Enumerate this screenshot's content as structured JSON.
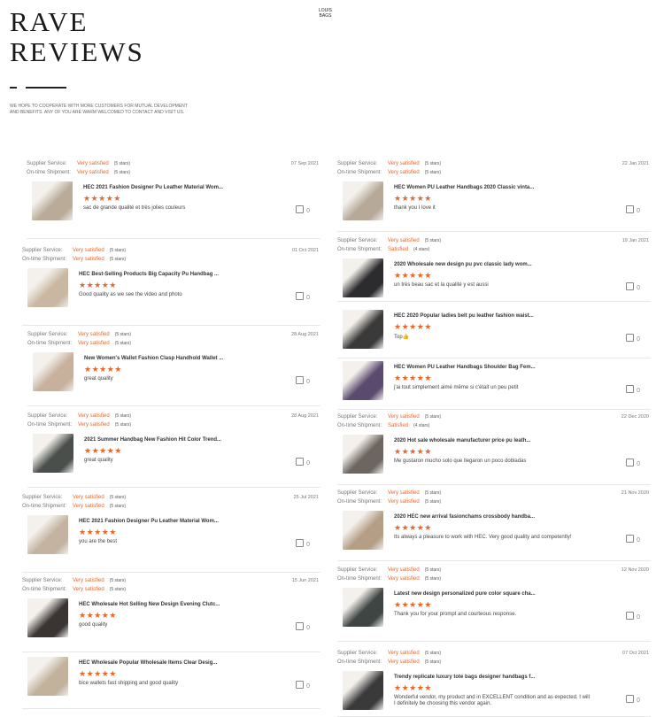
{
  "header": {
    "title_line1": "RAVE",
    "title_line2": "REVIEWS",
    "brand_line1": "LOUIS",
    "brand_line2": "BAGS",
    "intro_line1": "WE HOPE TO COOPERATE WITH MORE CUSTOMERS FOR MUTUAL DEVELOPMENT",
    "intro_line2": "AND BENEFITS. ANY OF YOU ARE WARM WELCOMED TO CONTACT AND VISIT US."
  },
  "labels": {
    "supplier": "Supplier Service:",
    "shipment": "On-time Shipment:"
  },
  "colors": {
    "accent": "#e7672a"
  },
  "reviews_left": [
    {
      "date": "07 Sep 2021",
      "supplier": "Very satisfied",
      "supplier_stars": "(5 stars)",
      "shipment": "Very satisfied",
      "shipment_stars": "(5 stars)",
      "product": "HEC 2021 Fashion Designer Pu Leather Material Wom...",
      "rating": "★★★★★",
      "text": "sac de grande qualité et très jolies couleurs",
      "likes": "0",
      "thumb": "#b9ab98"
    },
    {
      "date": "01 Oct 2021",
      "supplier": "Very satisfied",
      "supplier_stars": "(5 stars)",
      "shipment": "Very satisfied",
      "shipment_stars": "(5 stars)",
      "product": "HEC Best-Selling Products Big Capacity Pu Handbag ...",
      "rating": "★★★★★",
      "text": "Good quality as we see the video and photo",
      "likes": "0",
      "thumb": "#c9b7a1"
    },
    {
      "date": "28 Aug 2021",
      "supplier": "Very satisfied",
      "supplier_stars": "(5 stars)",
      "shipment": "Very satisfied",
      "shipment_stars": "(5 stars)",
      "product": "New Women's Wallet Fashion Clasp Handhold Wallet ...",
      "rating": "★★★★★",
      "text": "great quality",
      "likes": "0",
      "thumb": "#c7b09c"
    },
    {
      "date": "28 Aug 2021",
      "supplier": "Very satisfied",
      "supplier_stars": "(5 stars)",
      "shipment": "Very satisfied",
      "shipment_stars": "(5 stars)",
      "product": "2021 Summer Handbag New Fashion Hit Color Trend...",
      "rating": "★★★★★",
      "text": "great quality",
      "likes": "0",
      "thumb": "#4a4f4c"
    },
    {
      "date": "25 Jul 2021",
      "supplier": "Very satisfied",
      "supplier_stars": "(5 stars)",
      "shipment": "Very satisfied",
      "shipment_stars": "(5 stars)",
      "product": "HEC 2021 Fashion Designer Pu Leather Material Wom...",
      "rating": "★★★★★",
      "text": "you are the best",
      "likes": "0",
      "thumb": "#c4b3a0"
    },
    {
      "date": "15 Jun 2021",
      "supplier": "Very satisfied",
      "supplier_stars": "(5 stars)",
      "shipment": "Very satisfied",
      "shipment_stars": "(5 stars)",
      "product": "HEC Wholesale Hot Selling New Design Evening Clutc...",
      "rating": "★★★★★",
      "text": "good quality",
      "likes": "0",
      "thumb": "#3a3433"
    },
    {
      "date": "",
      "supplier": "",
      "supplier_stars": "",
      "shipment": "",
      "shipment_stars": "",
      "product": "HEC Wholesale Popular Wholesale Items Clear Desig...",
      "rating": "★★★★★",
      "text": "bice wallets fast shipping and good quality",
      "likes": "0",
      "thumb": "#c2b19b"
    }
  ],
  "reviews_right": [
    {
      "date": "22 Jan 2021",
      "supplier": "Very satisfied",
      "supplier_stars": "(5 stars)",
      "shipment": "Very satisfied",
      "shipment_stars": "(5 stars)",
      "product": "HEC Women PU Leather Handbags 2020 Classic vinta...",
      "rating": "★★★★★",
      "text": "thank you I love it",
      "likes": "0",
      "thumb": "#b7a998"
    },
    {
      "date": "19 Jan 2021",
      "supplier": "Very satisfied",
      "supplier_stars": "(5 stars)",
      "shipment": "Satisfied",
      "shipment_stars": "(4 stars)",
      "product": "2020 Wholesale new design pu pvc classic lady wom...",
      "rating": "★★★★★",
      "text": "un très beau sac et la qualité y est aussi",
      "likes": "0",
      "thumb": "#2c2b2d"
    },
    {
      "date": "",
      "supplier": "",
      "supplier_stars": "",
      "shipment": "",
      "shipment_stars": "",
      "product": "HEC 2020 Popular ladies belt pu leather fashion waist...",
      "rating": "★★★★★",
      "text": "Top👍",
      "likes": "0",
      "thumb": "#3b3a3a"
    },
    {
      "date": "",
      "supplier": "",
      "supplier_stars": "",
      "shipment": "",
      "shipment_stars": "",
      "product": "HEC Women PU Leather Handbags Shoulder Bag Fem...",
      "rating": "★★★★★",
      "text": "j'ai tout simplement aimé même si c'était un peu petit",
      "likes": "0",
      "thumb": "#5a4a6e"
    },
    {
      "date": "22 Dec 2020",
      "supplier": "Very satisfied",
      "supplier_stars": "(5 stars)",
      "shipment": "Satisfied",
      "shipment_stars": "(4 stars)",
      "product": "2020 Hot sale wholesale manufacturer price pu leath...",
      "rating": "★★★★★",
      "text": "Me gustaron mucho solo que llegaron un poco dobladas",
      "likes": "0",
      "thumb": "#6d6660"
    },
    {
      "date": "21 Nov 2020",
      "supplier": "Very satisfied",
      "supplier_stars": "(5 stars)",
      "shipment": "Very satisfied",
      "shipment_stars": "(5 stars)",
      "product": "2020 HEC new arrival fasionchams crossbody handba...",
      "rating": "★★★★★",
      "text": "Its always a pleasure to work with HEC. Very good quality and competently!",
      "likes": "0",
      "thumb": "#b59e86"
    },
    {
      "date": "12 Nov 2020",
      "supplier": "Very satisfied",
      "supplier_stars": "(5 stars)",
      "shipment": "Very satisfied",
      "shipment_stars": "(5 stars)",
      "product": "Latest new design personalized pure color square cha...",
      "rating": "★★★★★",
      "text": "Thank you for your prompt and courteous response.",
      "likes": "0",
      "thumb": "#3f4542"
    },
    {
      "date": "07 Oct 2021",
      "supplier": "Very satisfied",
      "supplier_stars": "(5 stars)",
      "shipment": "Very satisfied",
      "shipment_stars": "(5 stars)",
      "product": "Trendy replicate luxury tote bags designer handbags f...",
      "rating": "★★★★★",
      "text": "Wonderful vendor, my product and in EXCELLENT condition and as expected. I will",
      "text2": "I definitely be choosing this vendor again.",
      "likes": "0",
      "thumb": "#3b3a3b"
    }
  ]
}
